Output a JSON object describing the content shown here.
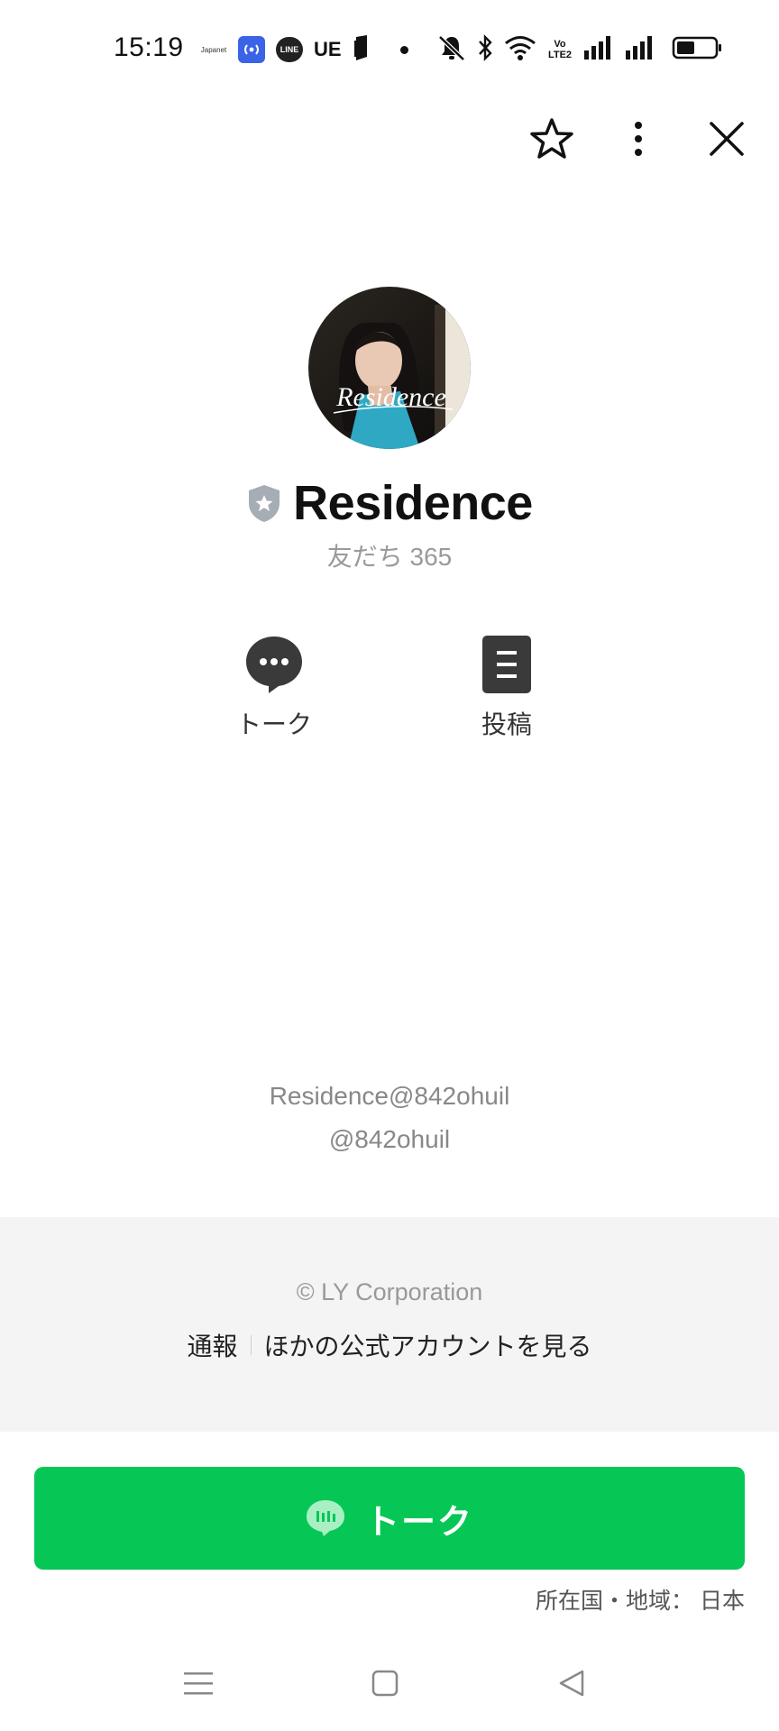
{
  "status_bar": {
    "time": "15:19",
    "notification_icons": [
      "japanet-icon",
      "broadcast-icon",
      "line-app-icon",
      "ue-icon",
      "doc-icon",
      "dot-icon"
    ],
    "mini_app_text": "Japanet",
    "line_icon_text": "LINE",
    "ue_text": "UE",
    "right_icons": [
      "mute-icon",
      "bluetooth-icon",
      "wifi-icon",
      "volte-icon",
      "signal-icon",
      "signal-icon",
      "battery-icon"
    ],
    "volte_text": "Vo LTE2",
    "battery_level": 0.45
  },
  "header": {
    "icons": [
      "star-icon",
      "more-vertical-icon",
      "close-icon"
    ]
  },
  "profile": {
    "avatar_script_text": "Residence",
    "verified_badge": "shield-badge-icon",
    "name": "Residence",
    "friends": "友だち 365"
  },
  "actions": [
    {
      "label": "トーク",
      "icon": "chat-bubble-icon"
    },
    {
      "label": "投稿",
      "icon": "post-icon"
    }
  ],
  "account": {
    "display_id": "Residence@842ohuil",
    "handle": "@842ohuil"
  },
  "footer": {
    "copyright": "© LY Corporation",
    "report_link": "通報",
    "other_accounts_link": "ほかの公式アカウントを見る"
  },
  "talk_button": {
    "label": "トーク",
    "icon": "line-chat-icon"
  },
  "region_text": "所在国・地域： 日本",
  "nav_bar": {
    "icons": [
      "menu-icon",
      "home-icon",
      "back-icon"
    ]
  },
  "colors": {
    "line_green": "#06c755",
    "footer_bg": "#f4f4f4",
    "muted_text": "#999999"
  }
}
